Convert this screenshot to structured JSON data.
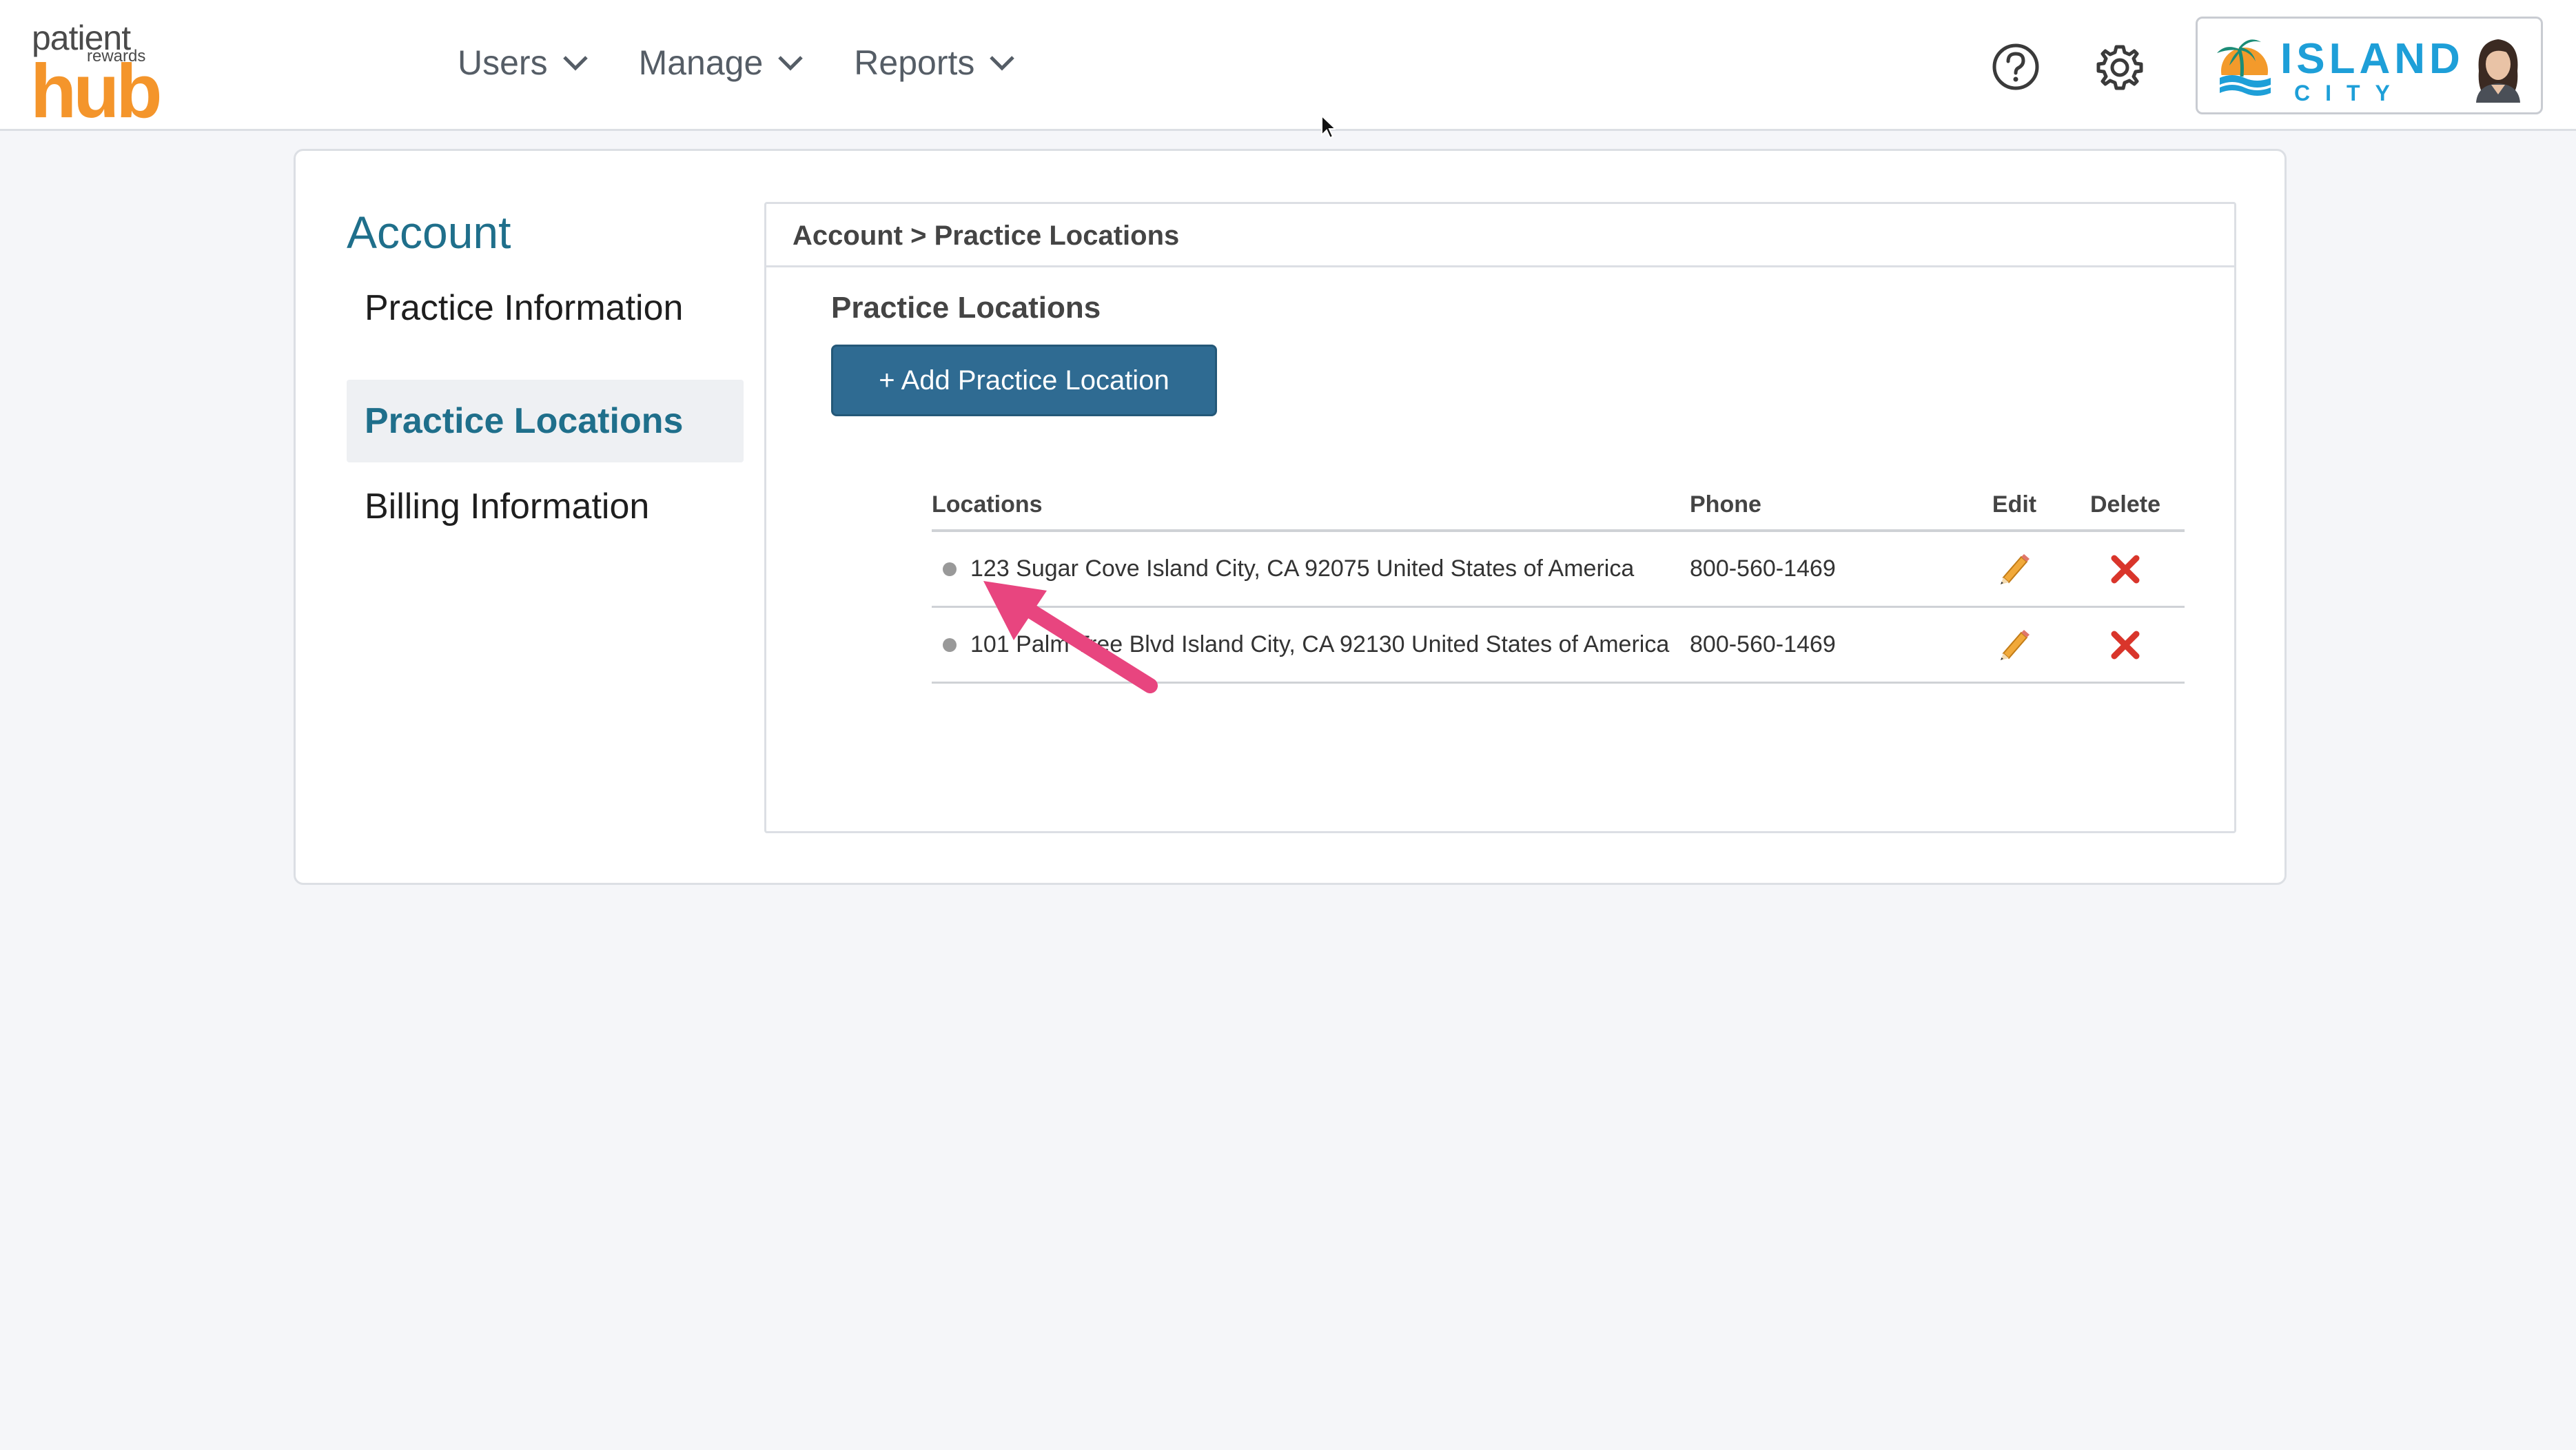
{
  "brand": {
    "logo_line1": "patient",
    "logo_line2": "rewards",
    "logo_line3": "hub",
    "practice_name": "ISLAND",
    "practice_sub": "CITY"
  },
  "nav": {
    "items": [
      {
        "label": "Users"
      },
      {
        "label": "Manage"
      },
      {
        "label": "Reports"
      }
    ]
  },
  "sidebar": {
    "title": "Account",
    "items": [
      {
        "label": "Practice Information",
        "active": false
      },
      {
        "label": "Practice Locations",
        "active": true
      },
      {
        "label": "Billing Information",
        "active": false
      }
    ]
  },
  "panel": {
    "breadcrumb": "Account > Practice Locations",
    "section_title": "Practice Locations",
    "add_button": "+ Add Practice Location",
    "table": {
      "columns": [
        "Locations",
        "Phone",
        "Edit",
        "Delete"
      ],
      "rows": [
        {
          "location": "123 Sugar Cove Island City, CA 92075 United States of America",
          "phone": "800-560-1469"
        },
        {
          "location": "101 Palm Tree Blvd Island City, CA 92130 United States of America",
          "phone": "800-560-1469"
        }
      ]
    }
  },
  "colors": {
    "accent": "#1f6f8b",
    "button": "#2f6b92",
    "logo_orange": "#f4952b",
    "annotation_arrow": "#e8457f",
    "delete_red": "#d9352b"
  },
  "icons": [
    "chevron-down-icon",
    "help-icon",
    "gear-icon",
    "pencil-icon",
    "close-icon",
    "cursor-icon"
  ]
}
